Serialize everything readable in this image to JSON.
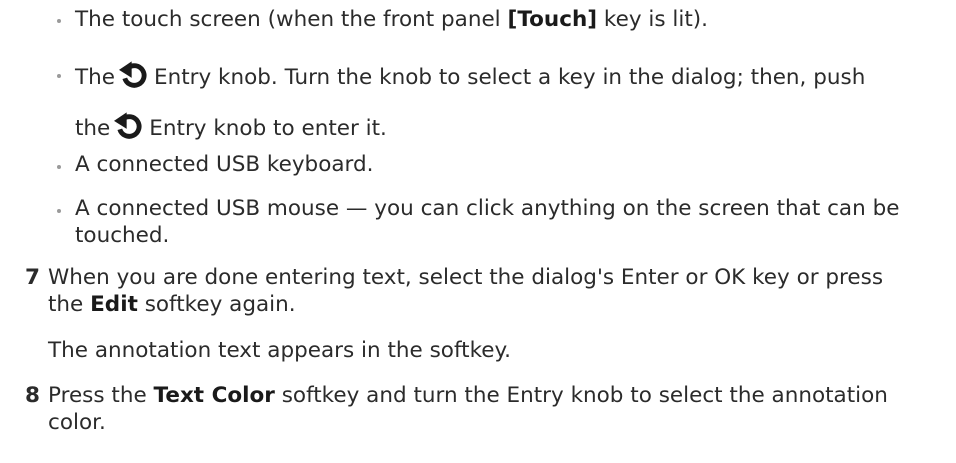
{
  "bullets": {
    "touch": {
      "before": "The touch screen (when the front panel ",
      "key": "[Touch]",
      "after": " key is lit)."
    },
    "knob": {
      "p1": "The",
      "p2": "Entry knob. Turn the knob to select a key in the dialog; then, push",
      "p3": "the",
      "p4": "Entry knob to enter it.",
      "icon": "entry-knob-rotate-icon"
    },
    "keyboard": "A connected USB keyboard.",
    "mouse": {
      "line1": "A connected USB mouse — you can click anything on the screen that can be",
      "line2": "touched."
    }
  },
  "steps": {
    "step7": {
      "number": "7",
      "line1": "When you are done entering text, select the dialog's Enter or OK key or press",
      "line2_before": "the ",
      "edit_key": "Edit",
      "line2_after": " softkey again.",
      "result": "The annotation text appears in the softkey."
    },
    "step8": {
      "number": "8",
      "before": "Press the ",
      "key": "Text Color",
      "after": " softkey and turn the Entry knob to select the annotation",
      "line2": "color."
    }
  },
  "colors": {
    "text": "#2b2b2b",
    "bullet": "#9a9a9a"
  }
}
